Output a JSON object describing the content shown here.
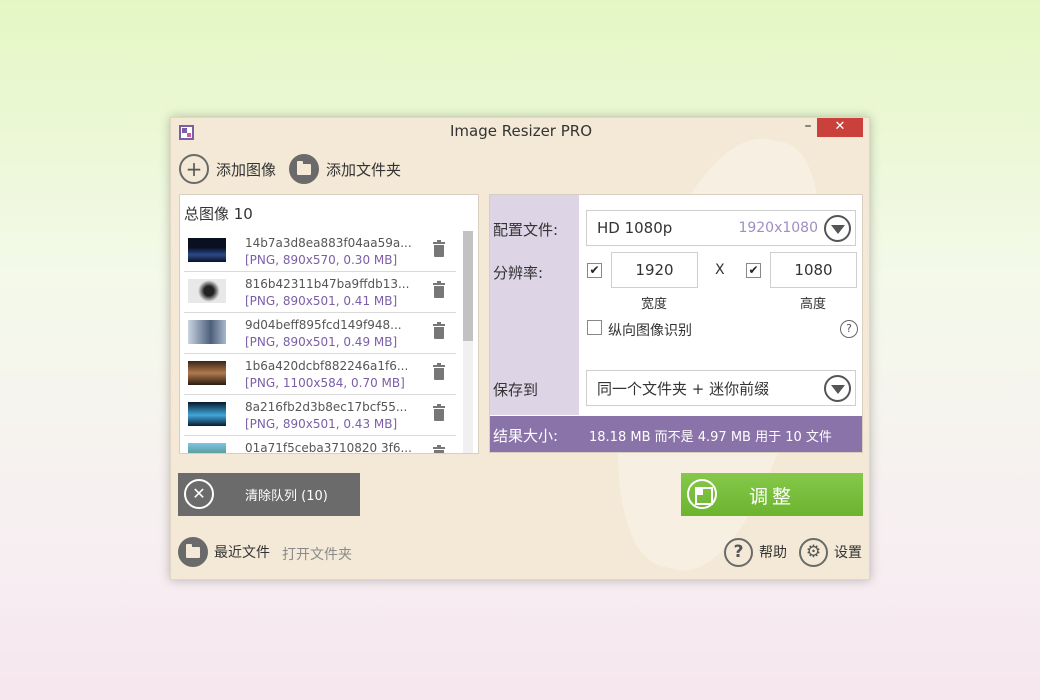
{
  "window": {
    "title": "Image Resizer PRO",
    "minimize": "–",
    "close": "✕"
  },
  "toolbar": {
    "add_image": "添加图像",
    "add_folder": "添加文件夹"
  },
  "list": {
    "header": "总图像 10",
    "items": [
      {
        "name": "14b7a3d8ea883f04aa59a...",
        "meta": "[PNG, 890x570, 0.30 MB]",
        "thumb": "#1f2a4a"
      },
      {
        "name": "816b42311b47ba9ffdb13...",
        "meta": "[PNG, 890x501, 0.41 MB]",
        "thumb": "#d7d7d7"
      },
      {
        "name": "9d04beff895fcd149f948...",
        "meta": "[PNG, 890x501, 0.49 MB]",
        "thumb": "#8ea0b8"
      },
      {
        "name": "1b6a420dcbf882246a1f6...",
        "meta": "[PNG, 1100x584, 0.70 MB]",
        "thumb": "#6b4a35"
      },
      {
        "name": "8a216fb2d3b8ec17bcf55...",
        "meta": "[PNG, 890x501, 0.43 MB]",
        "thumb": "#1c3a5c"
      },
      {
        "name": "01a71f5ceba3710820 3f6...",
        "meta": "",
        "thumb": "#5fa0c8"
      }
    ]
  },
  "settings": {
    "profile_label": "配置文件:",
    "profile_value": "HD 1080p",
    "profile_hint": "1920x1080",
    "resolution_label": "分辨率:",
    "width_value": "1920",
    "x_sep": "X",
    "height_value": "1080",
    "width_label": "宽度",
    "height_label": "高度",
    "portrait_label": "纵向图像识别",
    "help_q": "?",
    "save_label": "保存到",
    "save_value": "同一个文件夹 + 迷你前缀",
    "result_label": "结果大小:",
    "result_text": "18.18 MB 而不是 4.97 MB 用于 10 文件",
    "check_mark": "✔"
  },
  "buttons": {
    "clear_queue": "清除队列 (10)",
    "adjust": "调整"
  },
  "footer": {
    "recent": "最近文件",
    "open_folder": "打开文件夹",
    "help": "帮助",
    "settings": "设置",
    "help_q": "?",
    "gear": "⚙"
  },
  "colors": {
    "accent_purple": "#8a73a8",
    "adjust_green": "#7bbf3e",
    "close_red": "#c9413a"
  }
}
